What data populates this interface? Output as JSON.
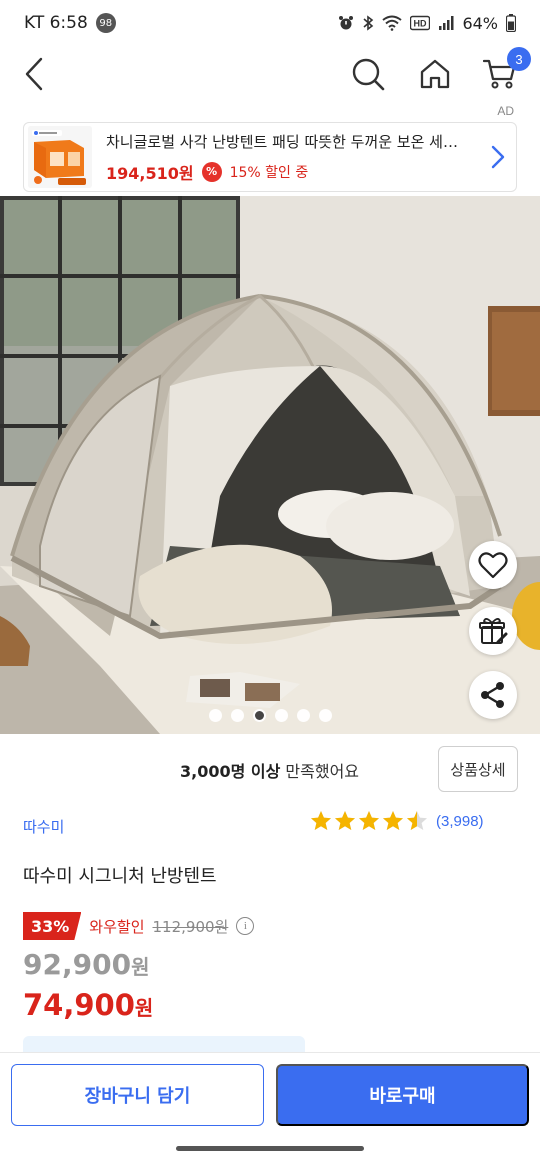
{
  "status_bar": {
    "carrier_time": "KT 6:58",
    "notification_count": "98",
    "network_label": "HD",
    "battery": "64%"
  },
  "nav": {
    "cart_count": "3"
  },
  "ad": {
    "label": "AD",
    "title": "차니글로벌 사각 난방텐트 패딩 따뜻한 두꺼운 보온 세…",
    "price": "194,510원",
    "discount_icon": "%",
    "discount_text": "15% 할인 중",
    "thumb_brand": "차니글로벌"
  },
  "hero": {
    "image_count": 6,
    "active_index": 2
  },
  "satisfaction": {
    "count_text": "3,000명 이상",
    "suffix_text": " 만족했어요",
    "detail_button": "상품상세"
  },
  "product": {
    "brand": "따수미",
    "rating": 4.5,
    "review_count": "(3,998)",
    "title": "따수미 시그니처 난방텐트",
    "discount_badge": "33%",
    "discount_label": "와우할인",
    "original_price": "112,900원",
    "info_icon_char": "i",
    "sale_price_number": "92,900",
    "sale_price_unit": "원",
    "final_price_number": "74,900",
    "final_price_unit": "원"
  },
  "bottom_bar": {
    "add_to_cart": "장바구니 담기",
    "buy_now": "바로구매"
  },
  "colors": {
    "accent": "#3a6df0",
    "sale_red": "#d9241b",
    "star": "#f5b400"
  }
}
